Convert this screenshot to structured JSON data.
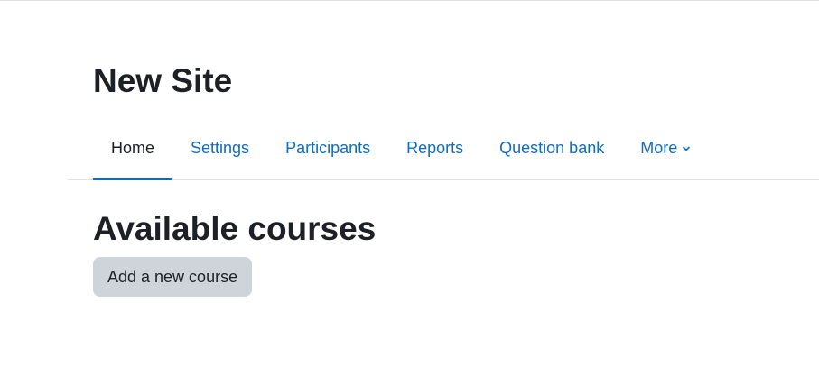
{
  "site": {
    "title": "New Site"
  },
  "nav": {
    "tabs": [
      {
        "label": "Home",
        "active": true
      },
      {
        "label": "Settings",
        "active": false
      },
      {
        "label": "Participants",
        "active": false
      },
      {
        "label": "Reports",
        "active": false
      },
      {
        "label": "Question bank",
        "active": false
      },
      {
        "label": "More",
        "active": false,
        "icon": "chevron-down-icon"
      }
    ]
  },
  "main": {
    "section_title": "Available courses",
    "add_course_label": "Add a new course"
  },
  "colors": {
    "link": "#0f6cbf",
    "text": "#1d2125",
    "button_bg": "#ced4da",
    "divider": "#dee2e6"
  }
}
